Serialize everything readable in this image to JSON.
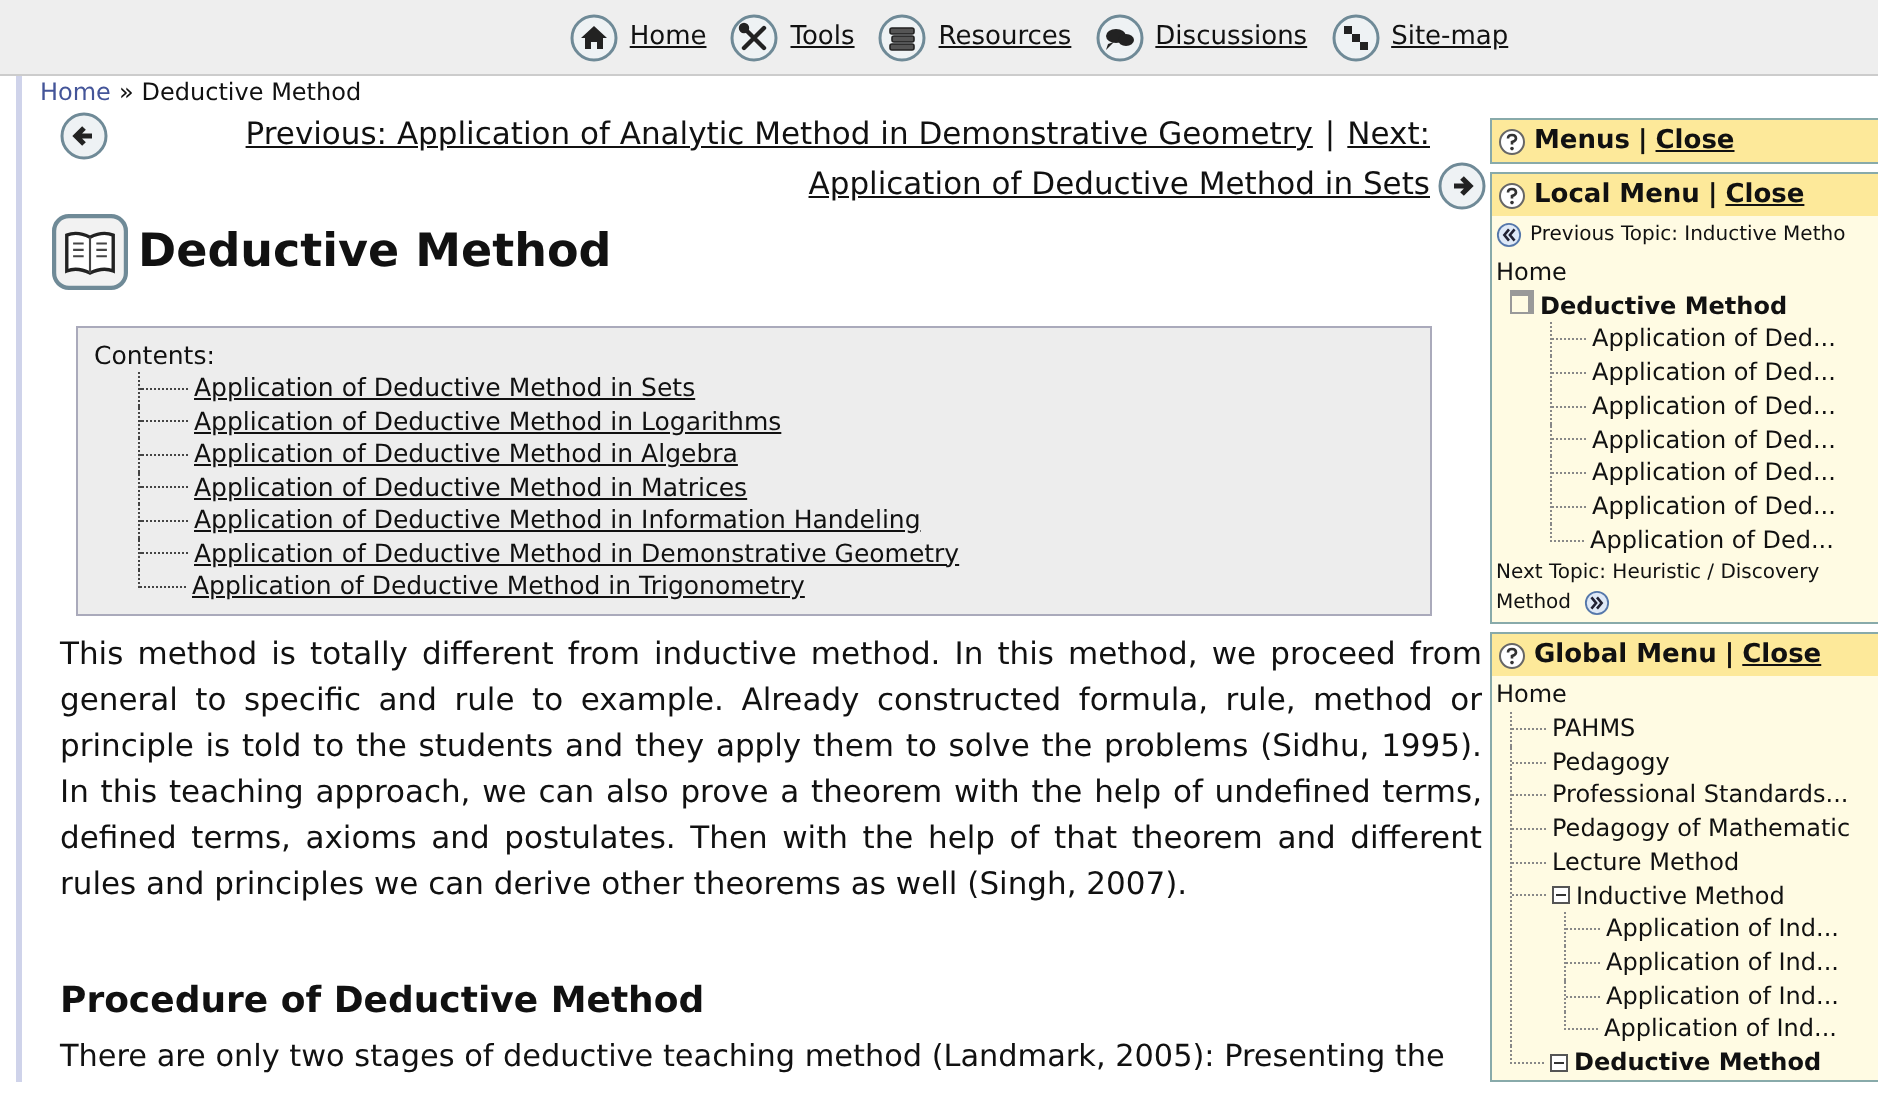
{
  "nav": [
    {
      "label": "Home"
    },
    {
      "label": "Tools"
    },
    {
      "label": "Resources"
    },
    {
      "label": "Discussions"
    },
    {
      "label": "Site-map"
    }
  ],
  "breadcrumb": {
    "home": "Home",
    "separator": "»",
    "current": "Deductive Method"
  },
  "pager": {
    "previous": "Previous: Application of Analytic Method in Demonstrative Geometry",
    "separator": "|",
    "next": "Next: Application of Deductive Method in Sets"
  },
  "title": "Deductive Method",
  "contents": {
    "label": "Contents:",
    "items": [
      "Application of Deductive Method in Sets",
      "Application of Deductive Method in Logarithms",
      "Application of Deductive Method in Algebra",
      "Application of Deductive Method in Matrices",
      "Application of Deductive Method in Information Handeling",
      "Application of Deductive Method in Demonstrative Geometry",
      "Application of Deductive Method in Trigonometry"
    ]
  },
  "paragraph": "This method is totally different from inductive method. In this method, we proceed from general to specific and rule to example. Already constructed formula, rule, method or principle is told to the students and they apply them to solve the problems (Sidhu, 1995). In this teaching approach, we can also prove a theorem with the help of undefined terms, defined terms, axioms and postulates. Then with the help of that theorem and different rules and principles we can derive other theorems as well (Singh, 2007).",
  "heading": "Procedure of Deductive Method",
  "paragraph_2": "There are only two stages of deductive teaching method (Landmark, 2005): Presenting the",
  "sidebar": {
    "menus": {
      "title": "Menus",
      "separator": "|",
      "close": "Close"
    },
    "local_menu": {
      "title": "Local Menu",
      "separator": "|",
      "close": "Close",
      "previous_topic": "Previous Topic: Inductive Metho",
      "tree": [
        {
          "label": "Home",
          "selected": false,
          "children": [
            {
              "label": "Deductive Method",
              "selected": true,
              "children": [
                {
                  "label": "Application of Ded...",
                  "selected": false
                },
                {
                  "label": "Application of Ded...",
                  "selected": false
                },
                {
                  "label": "Application of Ded...",
                  "selected": false
                },
                {
                  "label": "Application of Ded...",
                  "selected": false
                },
                {
                  "label": "Application of Ded...",
                  "selected": false
                },
                {
                  "label": "Application of Ded...",
                  "selected": false
                },
                {
                  "label": "Application of Ded...",
                  "selected": false
                }
              ]
            }
          ]
        }
      ],
      "next_topic": "Next Topic: Heuristic / Discovery Method"
    },
    "global_menu": {
      "title": "Global Menu",
      "separator": "|",
      "close": "Close",
      "tree": [
        {
          "label": "Home",
          "selected": false,
          "children": [
            {
              "label": "PAHMS",
              "selected": false
            },
            {
              "label": "Pedagogy",
              "selected": false
            },
            {
              "label": "Professional Standards...",
              "selected": false
            },
            {
              "label": "Pedagogy of Mathematic",
              "selected": false
            },
            {
              "label": "Lecture Method",
              "selected": false
            },
            {
              "label": "Inductive Method",
              "selected": false,
              "expanded": true,
              "children": [
                {
                  "label": "Application of Ind...",
                  "selected": false
                },
                {
                  "label": "Application of Ind...",
                  "selected": false
                },
                {
                  "label": "Application of Ind...",
                  "selected": false
                },
                {
                  "label": "Application of Ind...",
                  "selected": false
                }
              ]
            },
            {
              "label": "Deductive Method",
              "selected": true,
              "expanded": true
            }
          ]
        }
      ]
    }
  }
}
